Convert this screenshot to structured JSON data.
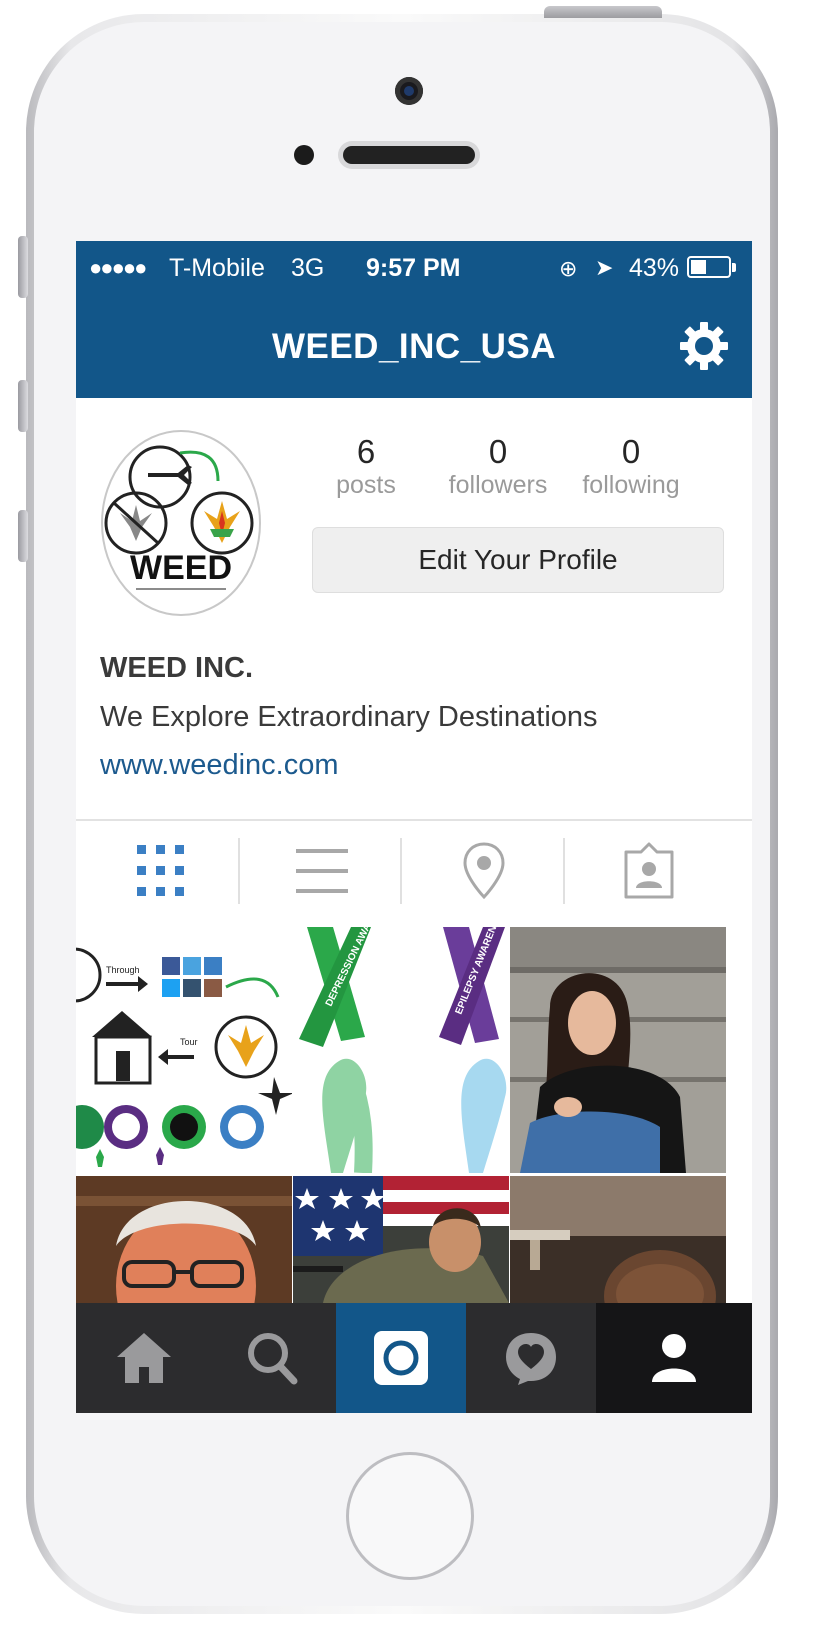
{
  "device": {
    "model_hint": "smartphone"
  },
  "statusbar": {
    "signal_dots": "●●●●●",
    "carrier": "T-Mobile",
    "network": "3G",
    "time": "9:57 PM",
    "orientation_lock_icon": "⊕",
    "location_icon": "➤",
    "battery_percent": "43%",
    "battery_level": 0.43
  },
  "header": {
    "username": "WEED_INC_USA",
    "settings_icon": "gear-icon",
    "color": "#125689"
  },
  "profile": {
    "avatar_logo_text": "WEED",
    "stats": [
      {
        "value": "6",
        "label": "posts"
      },
      {
        "value": "0",
        "label": "followers"
      },
      {
        "value": "0",
        "label": "following"
      }
    ],
    "edit_button": "Edit Your Profile",
    "name": "WEED INC.",
    "tagline": "We Explore Extraordinary Destinations",
    "website": "www.weedinc.com"
  },
  "view_tabs": [
    {
      "name": "grid-view",
      "icon": "grid-icon",
      "active": true
    },
    {
      "name": "list-view",
      "icon": "list-icon",
      "active": false
    },
    {
      "name": "map-view",
      "icon": "location-pin-icon",
      "active": false
    },
    {
      "name": "tagged-view",
      "icon": "tagged-user-icon",
      "active": false
    }
  ],
  "posts": [
    {
      "kind": "infographic-collage",
      "texts": [
        "Through",
        "Tour"
      ]
    },
    {
      "kind": "awareness-ribbons",
      "texts": [
        "DEPRESSION AWARENESS",
        "EPILEPSY AWARENESS"
      ]
    },
    {
      "kind": "photo-sad-girl"
    },
    {
      "kind": "photo-elderly-man"
    },
    {
      "kind": "photo-soldier-flag"
    },
    {
      "kind": "photo-woman-hair"
    }
  ],
  "bottom_nav": [
    {
      "name": "home",
      "icon": "home-icon",
      "active": false
    },
    {
      "name": "search",
      "icon": "search-icon",
      "active": false
    },
    {
      "name": "camera",
      "icon": "camera-icon",
      "active": false,
      "highlight": "#125689"
    },
    {
      "name": "activity",
      "icon": "heart-bubble-icon",
      "active": false
    },
    {
      "name": "profile",
      "icon": "person-icon",
      "active": true
    }
  ],
  "colors": {
    "accent": "#125689",
    "link": "#1c5a8e",
    "tab_active": "#3b7fc4",
    "nav_bg": "#2c2c2e",
    "nav_active_bg": "#151517"
  }
}
